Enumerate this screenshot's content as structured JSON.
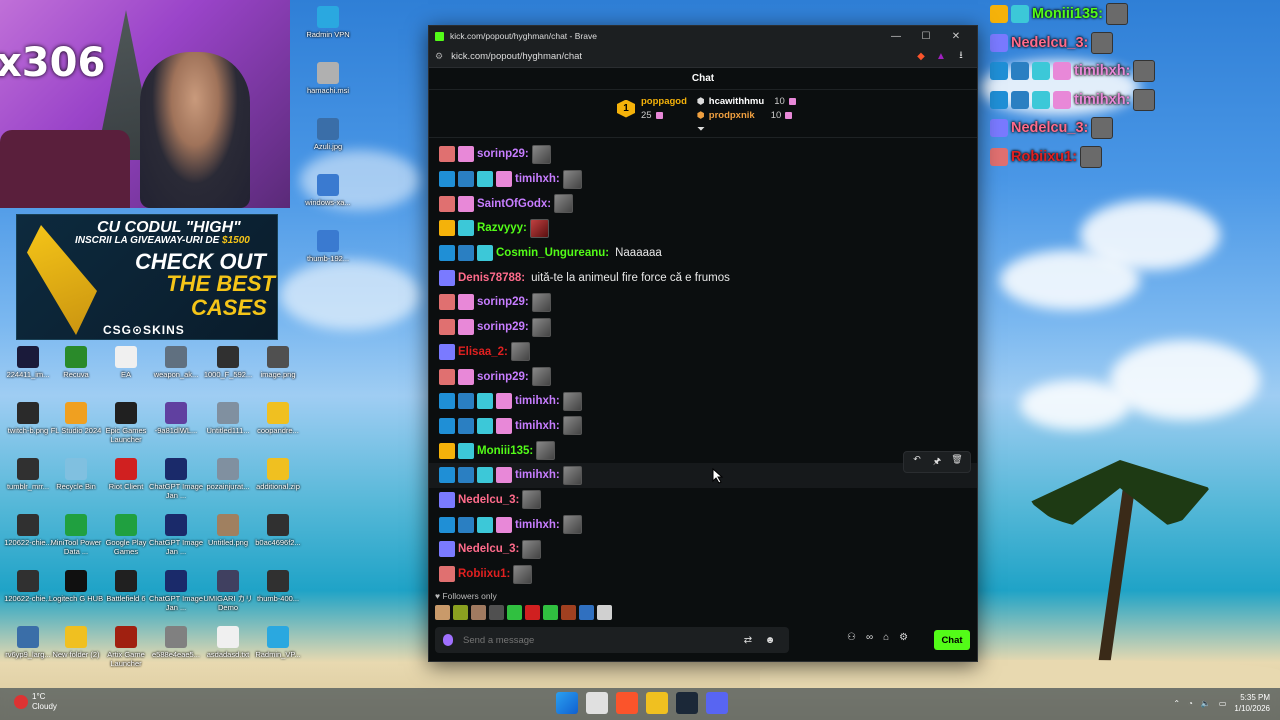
{
  "browser": {
    "tab_title": "kick.com/popout/hyghman/chat - Brave",
    "url": "kick.com/popout/hyghman/chat",
    "minimize": "—",
    "maximize": "☐",
    "close": "✕"
  },
  "chat": {
    "header": "Chat",
    "pinned": {
      "top_user": "poppagod",
      "top_count": "25",
      "top_rank": "1",
      "user2": "hcawithhmu",
      "user2_count": "10",
      "user3": "prodpxnik",
      "user3_count": "10"
    },
    "messages": [
      {
        "badges": [
          "vip",
          "gift"
        ],
        "user": "sorinp29:",
        "color": "#c77dff",
        "emote": true
      },
      {
        "badges": [
          "mod",
          "og",
          "sub",
          "gift"
        ],
        "user": "timihxh:",
        "color": "#c77dff",
        "emote": true
      },
      {
        "badges": [
          "vip",
          "gift"
        ],
        "user": "SaintOfGodx:",
        "color": "#c77dff",
        "emote": true
      },
      {
        "badges": [
          "crown",
          "sub"
        ],
        "user": "Razvyyy:",
        "color": "#53fc18",
        "emote": true,
        "emote_red": true
      },
      {
        "badges": [
          "mod",
          "og",
          "sub"
        ],
        "user": "Cosmin_Ungureanu:",
        "color": "#53fc18",
        "text": "Naaaaaa"
      },
      {
        "badges": [
          "blue"
        ],
        "user": "Denis78788:",
        "color": "#ff6b8b",
        "text": "uită-te la animeul fire force că e frumos"
      },
      {
        "badges": [
          "vip",
          "gift"
        ],
        "user": "sorinp29:",
        "color": "#c77dff",
        "emote": true
      },
      {
        "badges": [
          "vip",
          "gift"
        ],
        "user": "sorinp29:",
        "color": "#c77dff",
        "emote": true
      },
      {
        "badges": [
          "blue"
        ],
        "user": "Elisaa_2:",
        "color": "#e02020",
        "emote": true
      },
      {
        "badges": [
          "vip",
          "gift"
        ],
        "user": "sorinp29:",
        "color": "#c77dff",
        "emote": true
      },
      {
        "badges": [
          "mod",
          "og",
          "sub",
          "gift"
        ],
        "user": "timihxh:",
        "color": "#c77dff",
        "emote": true
      },
      {
        "badges": [
          "mod",
          "og",
          "sub",
          "gift"
        ],
        "user": "timihxh:",
        "color": "#c77dff",
        "emote": true
      },
      {
        "badges": [
          "crown",
          "sub"
        ],
        "user": "Moniii135:",
        "color": "#53fc18",
        "emote": true
      },
      {
        "badges": [
          "mod",
          "og",
          "sub",
          "gift"
        ],
        "user": "timihxh:",
        "color": "#c77dff",
        "emote": true,
        "highlight": true
      },
      {
        "badges": [
          "blue"
        ],
        "user": "Nedelcu_3:",
        "color": "#ff6b8b",
        "emote": true
      },
      {
        "badges": [
          "mod",
          "og",
          "sub",
          "gift"
        ],
        "user": "timihxh:",
        "color": "#c77dff",
        "emote": true
      },
      {
        "badges": [
          "blue"
        ],
        "user": "Nedelcu_3:",
        "color": "#ff6b8b",
        "emote": true
      },
      {
        "badges": [
          "vip"
        ],
        "user": "Robiixu1:",
        "color": "#e02020",
        "emote": true
      }
    ],
    "followers_only": "Followers only",
    "input_placeholder": "Send a message",
    "send_label": "Chat",
    "actions": [
      "↶",
      "🖈",
      "🗑"
    ]
  },
  "overlay": [
    {
      "user": "Moniii135:",
      "color": "#53fc18",
      "badges": [
        "crown",
        "sub"
      ]
    },
    {
      "user": "Nedelcu_3:",
      "color": "#ff6b8b",
      "badges": [
        "blue"
      ]
    },
    {
      "user": "timihxh:",
      "color": "#e888d8",
      "badges": [
        "mod",
        "og",
        "sub",
        "gift"
      ]
    },
    {
      "user": "timihxh:",
      "color": "#e888d8",
      "badges": [
        "mod",
        "og",
        "sub",
        "gift"
      ]
    },
    {
      "user": "Nedelcu_3:",
      "color": "#ff6b8b",
      "badges": [
        "blue"
      ]
    },
    {
      "user": "Robiixu1:",
      "color": "#e02020",
      "badges": [
        "vip"
      ]
    }
  ],
  "webcam": {
    "counter": "x306"
  },
  "promo": {
    "line1": "CU CODUL \"HIGH\"",
    "line2_a": "INSCRII LA GIVEAWAY-URI DE ",
    "line2_b": "$1500",
    "line3": "CHECK OUT",
    "line4": "THE BEST",
    "line5": "CASES",
    "brand": "CSG⊙SKINS"
  },
  "desktop_icons": [
    {
      "label": "Radmin VPN",
      "color": "#2aa8e0"
    },
    {
      "label": "hamachi.msi",
      "color": "#b0b0b0"
    },
    {
      "label": "Azuli.jpg",
      "color": "#3a6ea8"
    },
    {
      "label": "windows-xa...",
      "color": "#3a7ad0"
    },
    {
      "label": "thumb-192...",
      "color": "#3a7ad0"
    },
    {
      "label": "224411_im...",
      "color": "#1a1a3a"
    },
    {
      "label": "Recuva",
      "color": "#2a8a2a"
    },
    {
      "label": "EA",
      "color": "#f0f0f0"
    },
    {
      "label": "weapon_ak...",
      "color": "#607080"
    },
    {
      "label": "1000_F_592...",
      "color": "#303030"
    },
    {
      "label": "image.png",
      "color": "#505050"
    },
    {
      "label": "twitch-b.png",
      "color": "#2a2a2a"
    },
    {
      "label": "FL Studio 2024",
      "color": "#f0a020"
    },
    {
      "label": "Epic Games Launcher",
      "color": "#202020"
    },
    {
      "label": "-9a81dlWL...",
      "color": "#6040a0"
    },
    {
      "label": "Untitled111...",
      "color": "#8090a0"
    },
    {
      "label": "coopandre...",
      "color": "#f0c020"
    },
    {
      "label": "tumblr_mrr...",
      "color": "#303030"
    },
    {
      "label": "Recycle Bin",
      "color": "#80c0e0"
    },
    {
      "label": "Riot Client",
      "color": "#d02020"
    },
    {
      "label": "ChatGPT Image Jan ...",
      "color": "#1a2a6a"
    },
    {
      "label": "pozainjurat...",
      "color": "#8090a0"
    },
    {
      "label": "additional.zip",
      "color": "#f0c020"
    },
    {
      "label": "120622-chie...",
      "color": "#303030"
    },
    {
      "label": "MiniTool Power Data ...",
      "color": "#20a040"
    },
    {
      "label": "Google Play Games",
      "color": "#20a040"
    },
    {
      "label": "ChatGPT Image Jan ...",
      "color": "#1a2a6a"
    },
    {
      "label": "Untitled.png",
      "color": "#a08060"
    },
    {
      "label": "b0ac4696f2...",
      "color": "#303030"
    },
    {
      "label": "120622-chie...",
      "color": "#303030"
    },
    {
      "label": "Logitech G HUB",
      "color": "#101010"
    },
    {
      "label": "Battlefield 6",
      "color": "#202020"
    },
    {
      "label": "ChatGPT Image Jan ...",
      "color": "#1a2a6a"
    },
    {
      "label": "UMIGARI カリ Demo",
      "color": "#404060"
    },
    {
      "label": "thumb-400...",
      "color": "#303030"
    },
    {
      "label": "rv6yp9_larg...",
      "color": "#3a6ea8"
    },
    {
      "label": "New folder (2)",
      "color": "#f0c020"
    },
    {
      "label": "Artix Game Launcher",
      "color": "#a02010"
    },
    {
      "label": "e588e4eae5...",
      "color": "#808080"
    },
    {
      "label": "asdadasd.txt",
      "color": "#f0f0f0"
    },
    {
      "label": "Radmin_VP...",
      "color": "#2aa8e0"
    }
  ],
  "taskbar": {
    "weather_temp": "1°C",
    "weather_desc": "Cloudy",
    "time": "5:35 PM",
    "date": "1/10/2026"
  },
  "colors": {
    "kick_green": "#53fc18",
    "chat_bg": "#0b0e0f"
  }
}
